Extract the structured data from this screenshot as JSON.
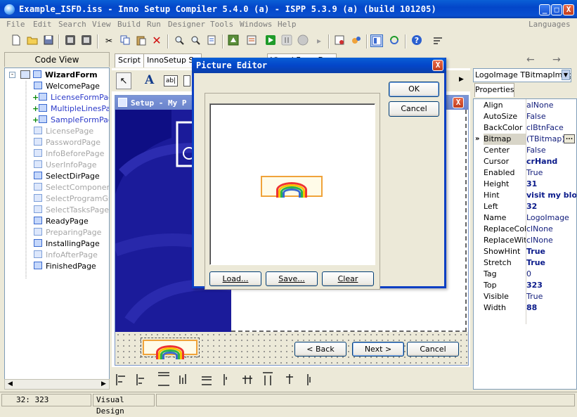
{
  "window": {
    "title": "Example_ISFD.iss - Inno Setup Compiler 5.4.0 (a) - ISPP 5.3.9 (a) (build 101205)",
    "min_label": "_",
    "max_label": "□",
    "close_label": "X"
  },
  "menu": {
    "items": [
      "File",
      "Edit",
      "Search",
      "View",
      "Build",
      "Run",
      "Designer",
      "Tools",
      "Windows",
      "Help"
    ],
    "languages": "Languages"
  },
  "left": {
    "code_view_label": "Code View",
    "tree": [
      {
        "label": "WizardForm",
        "style": "root"
      },
      {
        "label": "WelcomePage",
        "style": "normal"
      },
      {
        "label": "LicenseFormPage",
        "style": "blue"
      },
      {
        "label": "MultipleLinesPage",
        "style": "blue"
      },
      {
        "label": "SampleFormPage",
        "style": "blue"
      },
      {
        "label": "LicensePage",
        "style": "dim"
      },
      {
        "label": "PasswordPage",
        "style": "dim"
      },
      {
        "label": "InfoBeforePage",
        "style": "dim"
      },
      {
        "label": "UserInfoPage",
        "style": "dim"
      },
      {
        "label": "SelectDirPage",
        "style": "normal"
      },
      {
        "label": "SelectComponentsPage",
        "style": "dim"
      },
      {
        "label": "SelectProgramGroupPage",
        "style": "dim"
      },
      {
        "label": "SelectTasksPage",
        "style": "dim"
      },
      {
        "label": "ReadyPage",
        "style": "normal"
      },
      {
        "label": "PreparingPage",
        "style": "dim"
      },
      {
        "label": "InstallingPage",
        "style": "normal"
      },
      {
        "label": "InfoAfterPage",
        "style": "dim"
      },
      {
        "label": "FinishedPage",
        "style": "normal"
      }
    ]
  },
  "tabs": {
    "script": "Script",
    "inno": "InnoSetup Su",
    "visual": "Visual Form Des"
  },
  "designer": {
    "form_title": "Setup - My P",
    "back": "< Back",
    "next": "Next >",
    "cancel": "Cancel"
  },
  "dialog": {
    "title": "Picture Editor",
    "ok": "OK",
    "cancel": "Cancel",
    "load": "Load...",
    "save": "Save...",
    "clear": "Clear"
  },
  "inspector": {
    "combo": "LogoImage  TBitmapImage",
    "tab": "Properties",
    "props": [
      {
        "name": "Align",
        "value": "alNone",
        "bold": false
      },
      {
        "name": "AutoSize",
        "value": "False",
        "bold": false
      },
      {
        "name": "BackColor",
        "value": "clBtnFace",
        "bold": false
      },
      {
        "name": "Bitmap",
        "value": "(TBitmap)",
        "bold": false,
        "selected": true
      },
      {
        "name": "Center",
        "value": "False",
        "bold": false
      },
      {
        "name": "Cursor",
        "value": "crHand",
        "bold": true
      },
      {
        "name": "Enabled",
        "value": "True",
        "bold": false
      },
      {
        "name": "Height",
        "value": "31",
        "bold": true
      },
      {
        "name": "Hint",
        "value": "visit my blog",
        "bold": true
      },
      {
        "name": "Left",
        "value": "32",
        "bold": true
      },
      {
        "name": "Name",
        "value": "LogoImage",
        "bold": false
      },
      {
        "name": "ReplaceColor",
        "value": "clNone",
        "bold": false
      },
      {
        "name": "ReplaceWithColor",
        "value": "clNone",
        "bold": false
      },
      {
        "name": "ShowHint",
        "value": "True",
        "bold": true
      },
      {
        "name": "Stretch",
        "value": "True",
        "bold": true
      },
      {
        "name": "Tag",
        "value": "0",
        "bold": false
      },
      {
        "name": "Top",
        "value": "323",
        "bold": true
      },
      {
        "name": "Visible",
        "value": "True",
        "bold": false
      },
      {
        "name": "Width",
        "value": "88",
        "bold": true
      }
    ],
    "selected_marker": "»",
    "ellipsis": "..."
  },
  "status": {
    "pos": "32: 323",
    "mode": "Visual Design"
  },
  "icons": {
    "new": "new-file-icon",
    "open": "open-folder-icon",
    "save": "save-disk-icon",
    "run": "run-icon",
    "help": "help-icon"
  },
  "colors": {
    "title_blue": "#0346c9",
    "form_panel": "#0e0e84",
    "logo_border": "#f0a33a"
  }
}
